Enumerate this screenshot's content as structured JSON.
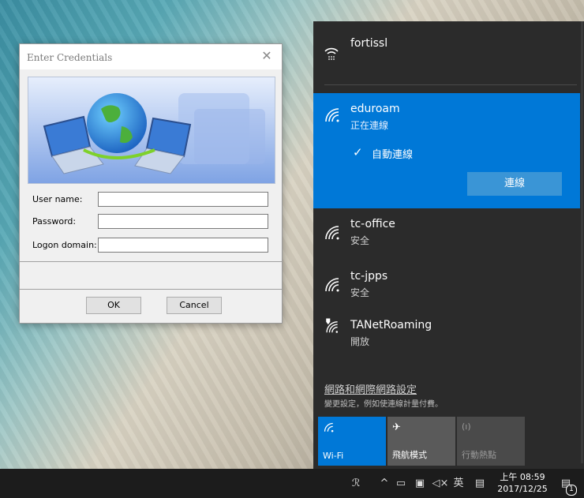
{
  "dialog": {
    "title": "Enter Credentials",
    "close_glyph": "✕",
    "fields": [
      {
        "label": "User name:",
        "value": ""
      },
      {
        "label": "Password:",
        "value": ""
      },
      {
        "label": "Logon domain:",
        "value": ""
      }
    ],
    "ok_label": "OK",
    "cancel_label": "Cancel"
  },
  "flyout": {
    "networks": [
      {
        "name": "fortissl",
        "status": "",
        "icon": "wifi-secure-icon"
      },
      {
        "name": "eduroam",
        "status": "正在連線",
        "icon": "wifi-icon"
      },
      {
        "name": "tc-office",
        "status": "安全",
        "icon": "wifi-icon"
      },
      {
        "name": "tc-jpps",
        "status": "安全",
        "icon": "wifi-icon"
      },
      {
        "name": "TANetRoaming",
        "status": "開放",
        "icon": "wifi-open-icon"
      }
    ],
    "auto_connect_label": "自動連線",
    "connect_label": "連線",
    "settings_link": "網路和網際網路設定",
    "settings_sub": "變更設定，例如使連線計量付費。",
    "tiles": [
      {
        "label": "Wi-Fi",
        "active": true
      },
      {
        "label": "飛航模式",
        "active": false
      },
      {
        "label": "行動熱點",
        "active": false
      }
    ],
    "accent_color": "#0078d7"
  },
  "taskbar": {
    "ime_label": "英",
    "time": "上午 08:59",
    "date": "2017/12/25",
    "notification_count": "1"
  }
}
